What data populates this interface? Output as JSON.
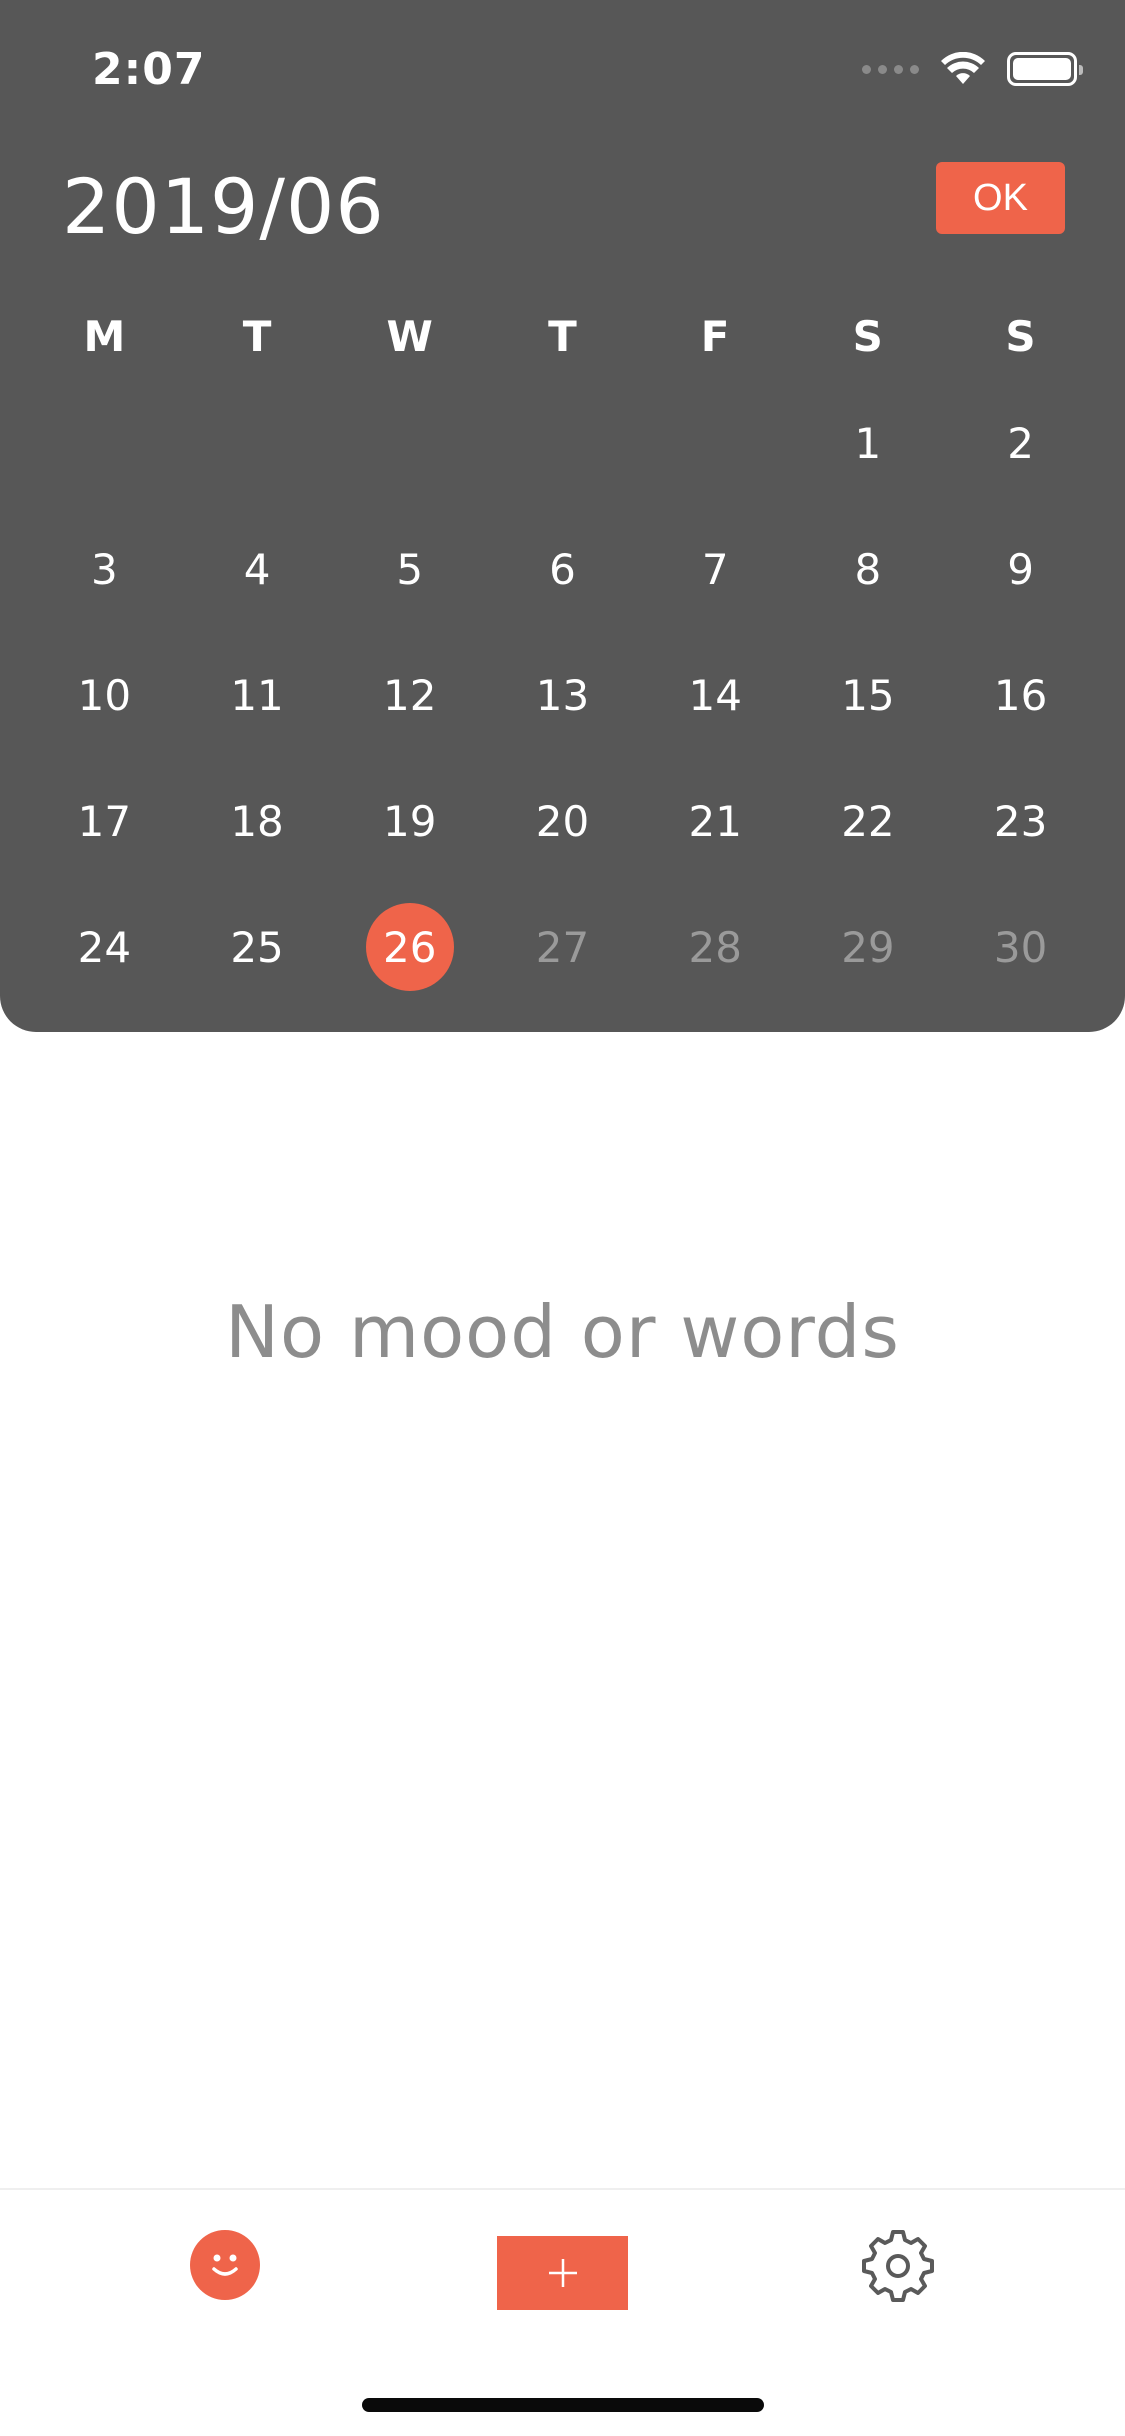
{
  "status_bar": {
    "time": "2:07"
  },
  "calendar": {
    "month_label": "2019/06",
    "ok_label": "OK",
    "weekdays": [
      "M",
      "T",
      "W",
      "T",
      "F",
      "S",
      "S"
    ],
    "leading_blanks": 5,
    "days_in_month": 30,
    "selected_day": 26,
    "last_available_day": 26
  },
  "main": {
    "empty_message": "No mood or words"
  },
  "colors": {
    "accent": "#ef644a",
    "panel": "#575757",
    "muted_day": "#9a9a9a",
    "empty_text": "#8d8d8d"
  },
  "tab_bar": {
    "icons": [
      "smiley-icon",
      "plus-icon",
      "gear-icon"
    ]
  }
}
